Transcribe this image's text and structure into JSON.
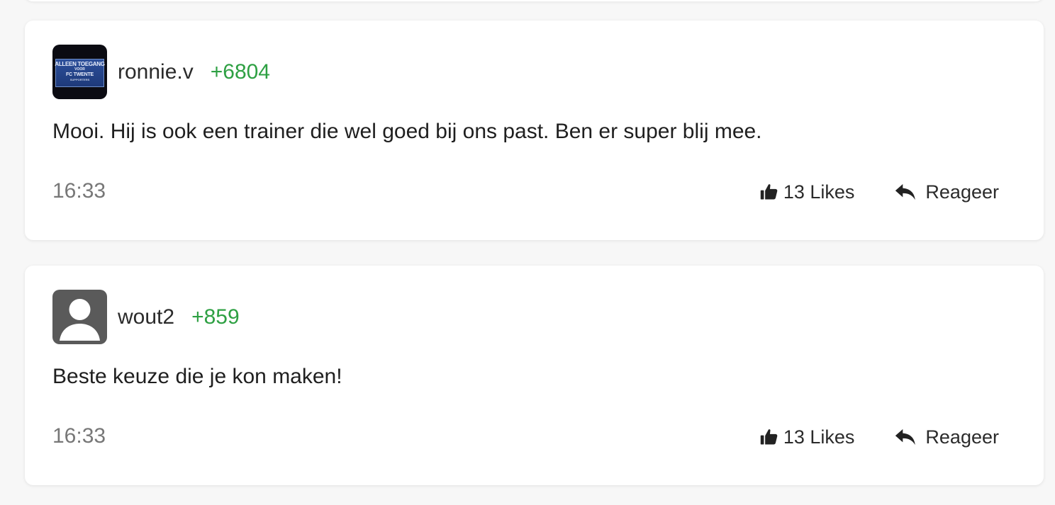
{
  "comments": [
    {
      "username": "ronnie.v",
      "points": "+6804",
      "avatar": {
        "type": "badge",
        "badge_text": [
          "ALLEEN TOEGANG",
          "VOOR",
          "FC TWENTE",
          "SUPPORTERS"
        ]
      },
      "text": "Mooi. Hij is ook een trainer die wel goed bij ons past. Ben er super blij mee.",
      "time": "16:33",
      "likes_label": "13 Likes",
      "reply_label": "Reageer"
    },
    {
      "username": "wout2",
      "points": "+859",
      "avatar": {
        "type": "default-user"
      },
      "text": "Beste keuze die je kon maken!",
      "time": "16:33",
      "likes_label": "13 Likes",
      "reply_label": "Reageer"
    }
  ],
  "icons": {
    "like": "thumbs-up-icon",
    "reply": "reply-arrow-icon",
    "default_avatar": "user-silhouette-icon"
  },
  "colors": {
    "points": "#2ea043",
    "card_background": "#ffffff",
    "page_background": "#f7f7f7",
    "timestamp": "#777777"
  }
}
